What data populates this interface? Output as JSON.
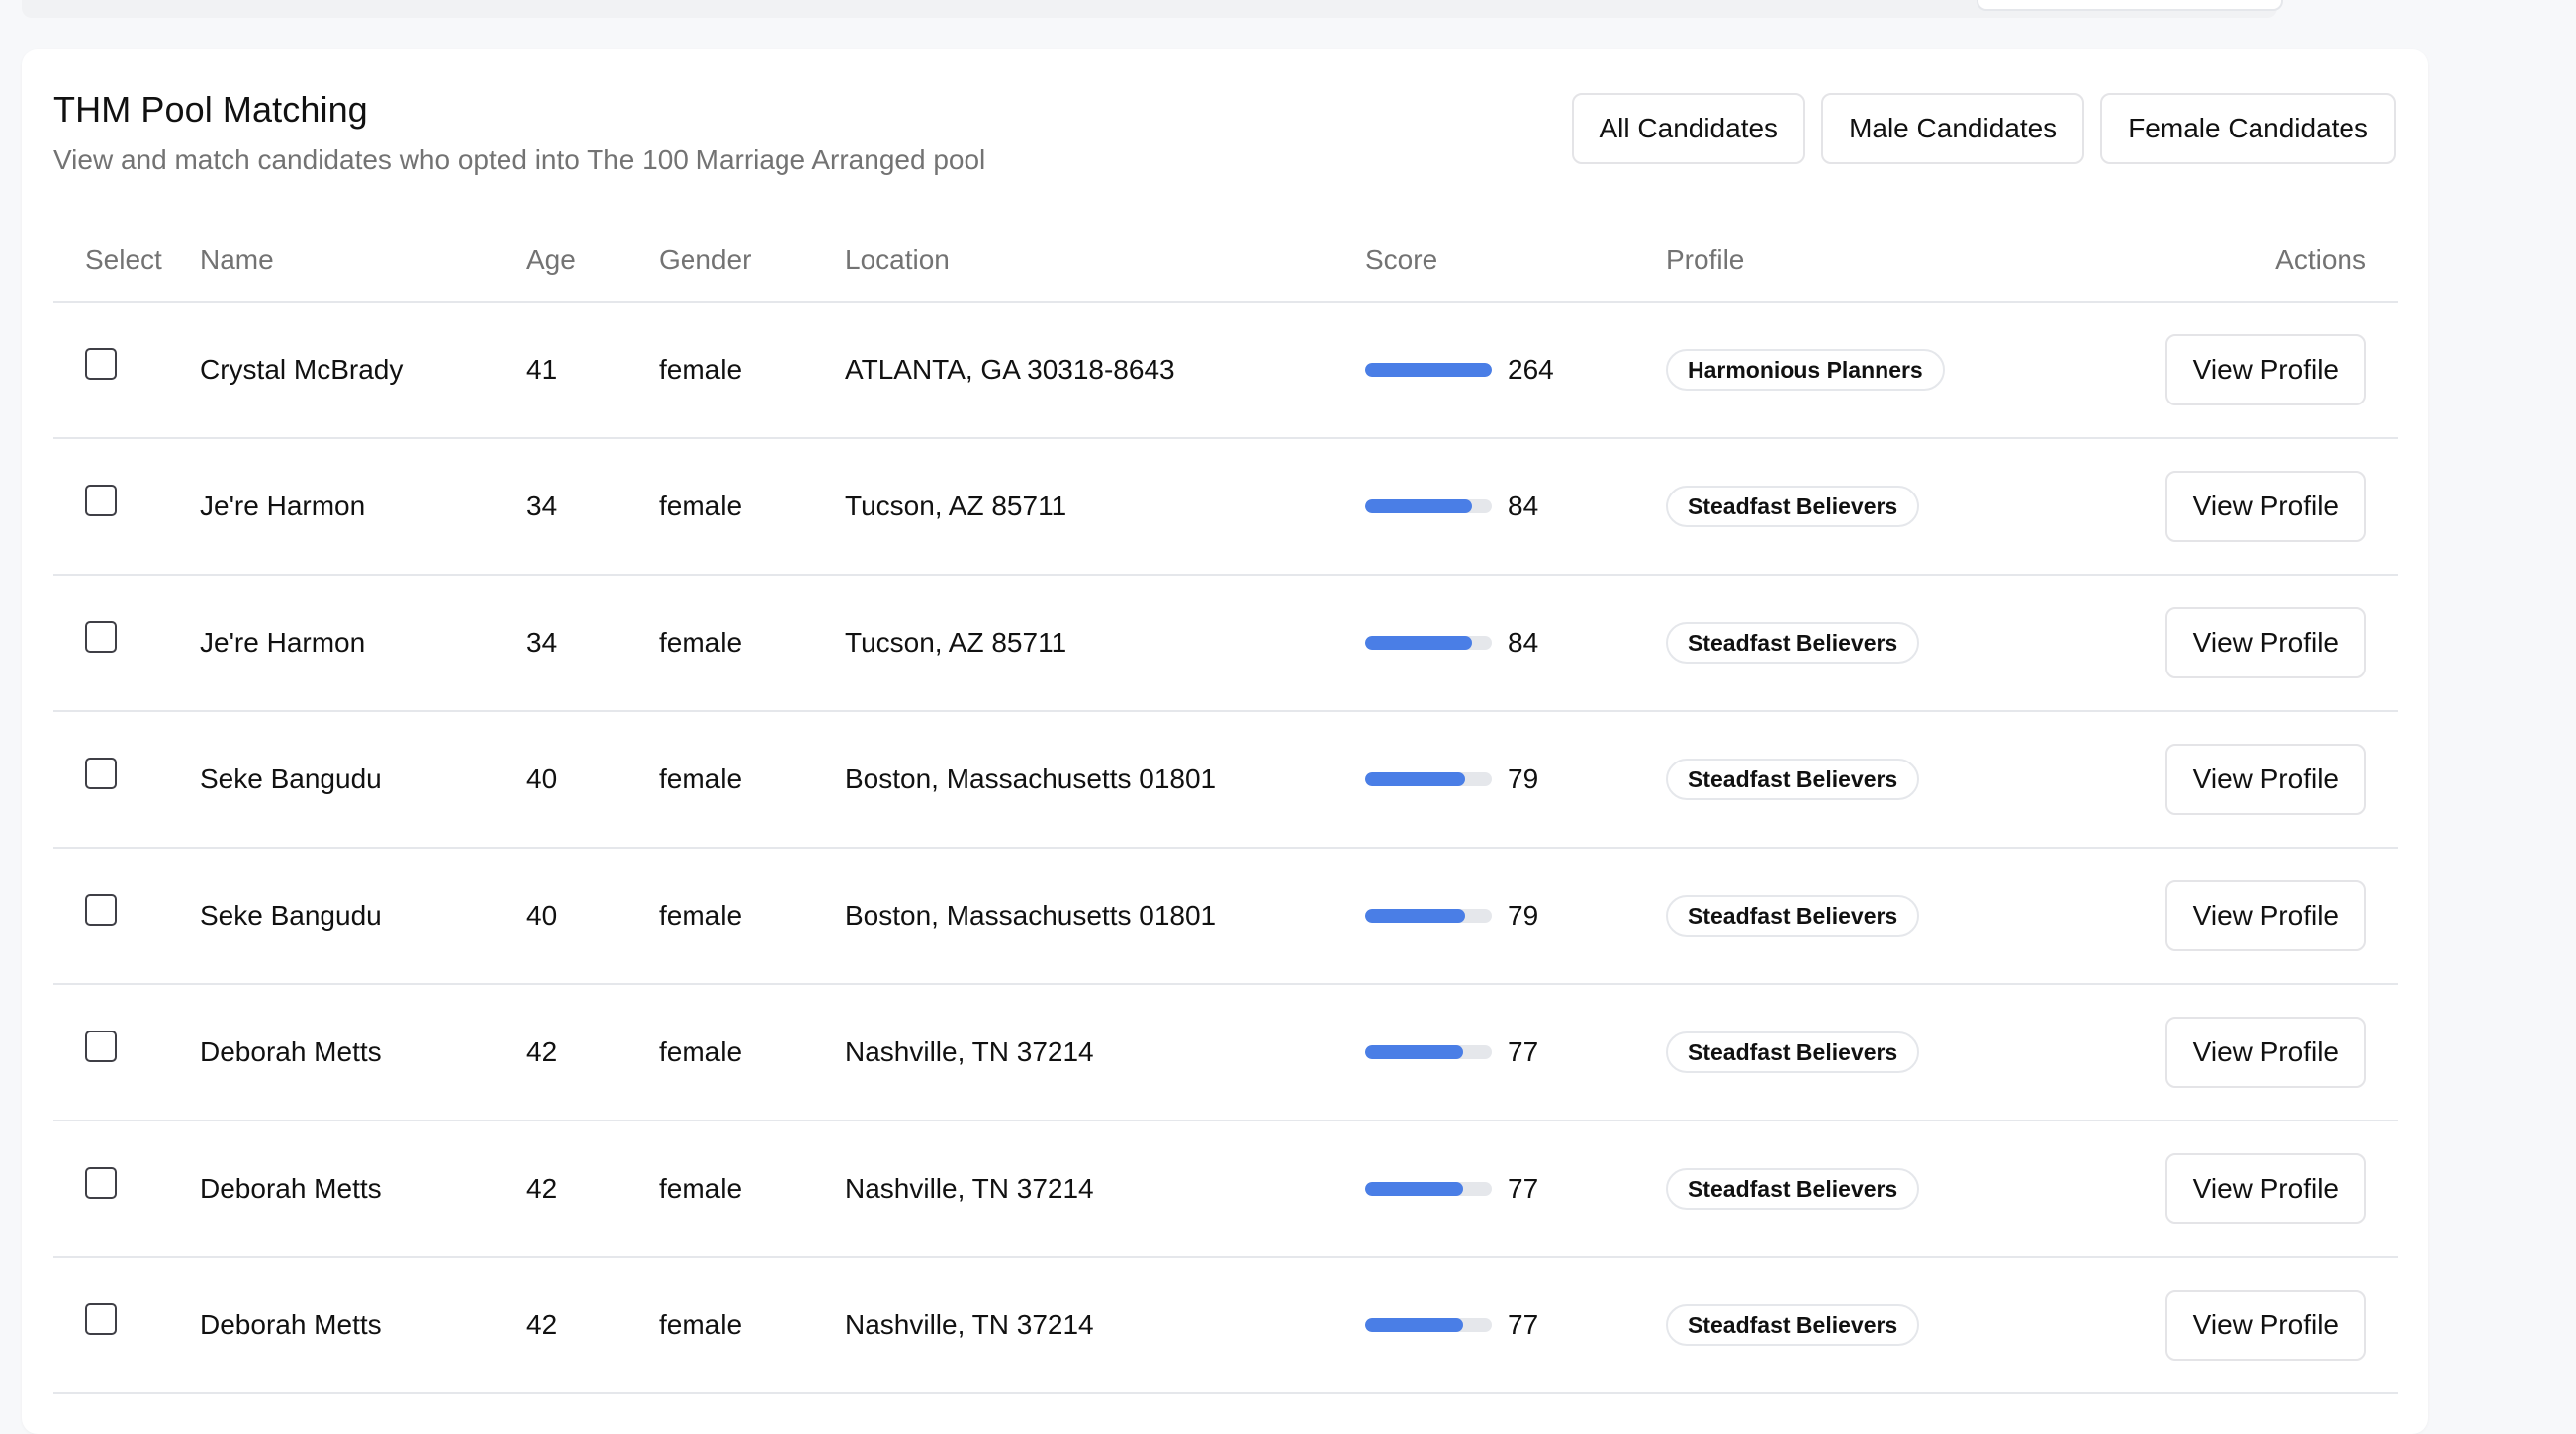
{
  "page": {
    "title": "THM Pool Matching",
    "subtitle": "View and match candidates who opted into The 100 Marriage Arranged pool"
  },
  "filters": [
    "All Candidates",
    "Male Candidates",
    "Female Candidates"
  ],
  "table": {
    "headers": {
      "select": "Select",
      "name": "Name",
      "age": "Age",
      "gender": "Gender",
      "location": "Location",
      "score": "Score",
      "profile": "Profile",
      "actions": "Actions"
    },
    "action_label": "View Profile",
    "score_max": 100,
    "rows": [
      {
        "name": "Crystal McBrady",
        "age": "41",
        "gender": "female",
        "location": "ATLANTA, GA 30318-8643",
        "score": "264",
        "profile": "Harmonious Planners"
      },
      {
        "name": "Je're Harmon",
        "age": "34",
        "gender": "female",
        "location": "Tucson, AZ 85711",
        "score": "84",
        "profile": "Steadfast Believers"
      },
      {
        "name": "Je're Harmon",
        "age": "34",
        "gender": "female",
        "location": "Tucson, AZ 85711",
        "score": "84",
        "profile": "Steadfast Believers"
      },
      {
        "name": "Seke Bangudu",
        "age": "40",
        "gender": "female",
        "location": "Boston, Massachusetts 01801",
        "score": "79",
        "profile": "Steadfast Believers"
      },
      {
        "name": "Seke Bangudu",
        "age": "40",
        "gender": "female",
        "location": "Boston, Massachusetts 01801",
        "score": "79",
        "profile": "Steadfast Believers"
      },
      {
        "name": "Deborah Metts",
        "age": "42",
        "gender": "female",
        "location": "Nashville, TN 37214",
        "score": "77",
        "profile": "Steadfast Believers"
      },
      {
        "name": "Deborah Metts",
        "age": "42",
        "gender": "female",
        "location": "Nashville, TN 37214",
        "score": "77",
        "profile": "Steadfast Believers"
      },
      {
        "name": "Deborah Metts",
        "age": "42",
        "gender": "female",
        "location": "Nashville, TN 37214",
        "score": "77",
        "profile": "Steadfast Believers"
      }
    ]
  },
  "colors": {
    "score_bar": "#4a7ee6",
    "score_track": "#e5e7eb",
    "border": "#e5e7eb",
    "muted_text": "#737373"
  }
}
